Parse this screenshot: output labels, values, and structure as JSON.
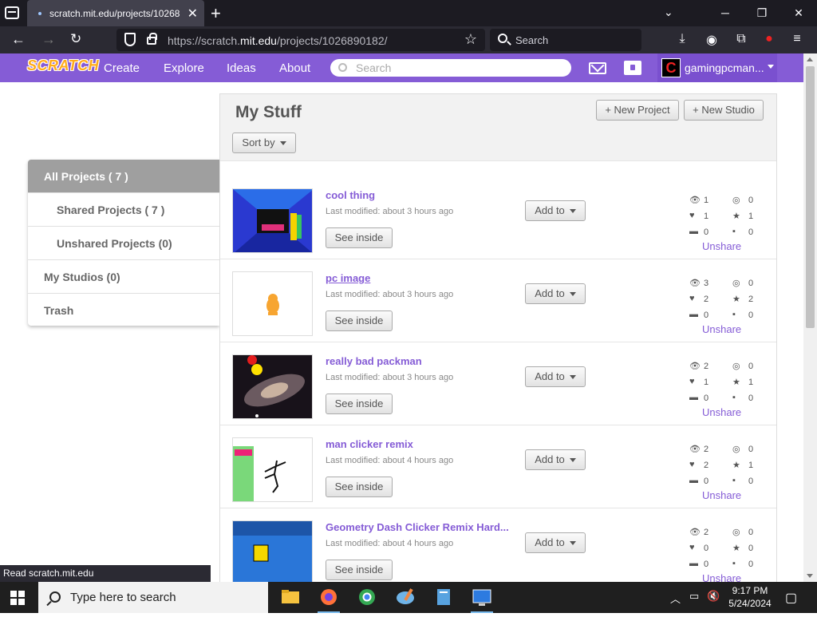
{
  "browser": {
    "tab_title": "scratch.mit.edu/projects/10268",
    "url_prefix": "https://scratch.",
    "url_domain": "mit.edu",
    "url_suffix": "/projects/1026890182/",
    "search_placeholder": "Search",
    "status_tooltip": "Read scratch.mit.edu"
  },
  "header": {
    "logo": "SCRATCH",
    "links": [
      "Create",
      "Explore",
      "Ideas",
      "About"
    ],
    "search_placeholder": "Search",
    "username": "gamingpcman...",
    "avatar_letter": "C"
  },
  "sidebar": {
    "items": [
      {
        "label": "All Projects ( 7 )"
      },
      {
        "label": "Shared Projects ( 7 )"
      },
      {
        "label": "Unshared Projects (0)"
      },
      {
        "label": "My Studios (0)"
      },
      {
        "label": "Trash"
      }
    ]
  },
  "main": {
    "title": "My Stuff",
    "new_project": "+ New Project",
    "new_studio": "+ New Studio",
    "sort_by": "Sort by",
    "see_inside": "See inside",
    "add_to": "Add to",
    "unshare": "Unshare",
    "projects": [
      {
        "title": "cool thing",
        "modified": "Last modified: about 3 hours ago",
        "views": "1",
        "remixes": "0",
        "loves": "1",
        "favorites": "1",
        "comments": "0",
        "studios": "0"
      },
      {
        "title": "pc image",
        "modified": "Last modified: about 3 hours ago",
        "views": "3",
        "remixes": "0",
        "loves": "2",
        "favorites": "2",
        "comments": "0",
        "studios": "0"
      },
      {
        "title": "really bad packman",
        "modified": "Last modified: about 3 hours ago",
        "views": "2",
        "remixes": "0",
        "loves": "1",
        "favorites": "1",
        "comments": "0",
        "studios": "0"
      },
      {
        "title": "man clicker remix",
        "modified": "Last modified: about 4 hours ago",
        "views": "2",
        "remixes": "0",
        "loves": "2",
        "favorites": "1",
        "comments": "0",
        "studios": "0"
      },
      {
        "title": "Geometry Dash Clicker Remix Hard...",
        "modified": "Last modified: about 4 hours ago",
        "views": "2",
        "remixes": "0",
        "loves": "0",
        "favorites": "0",
        "comments": "0",
        "studios": "0"
      }
    ]
  },
  "taskbar": {
    "search_placeholder": "Type here to search",
    "time": "9:17 PM",
    "date": "5/24/2024"
  },
  "colors": {
    "scratch_purple": "#855cd6",
    "browser_dark": "#1c1b22"
  }
}
